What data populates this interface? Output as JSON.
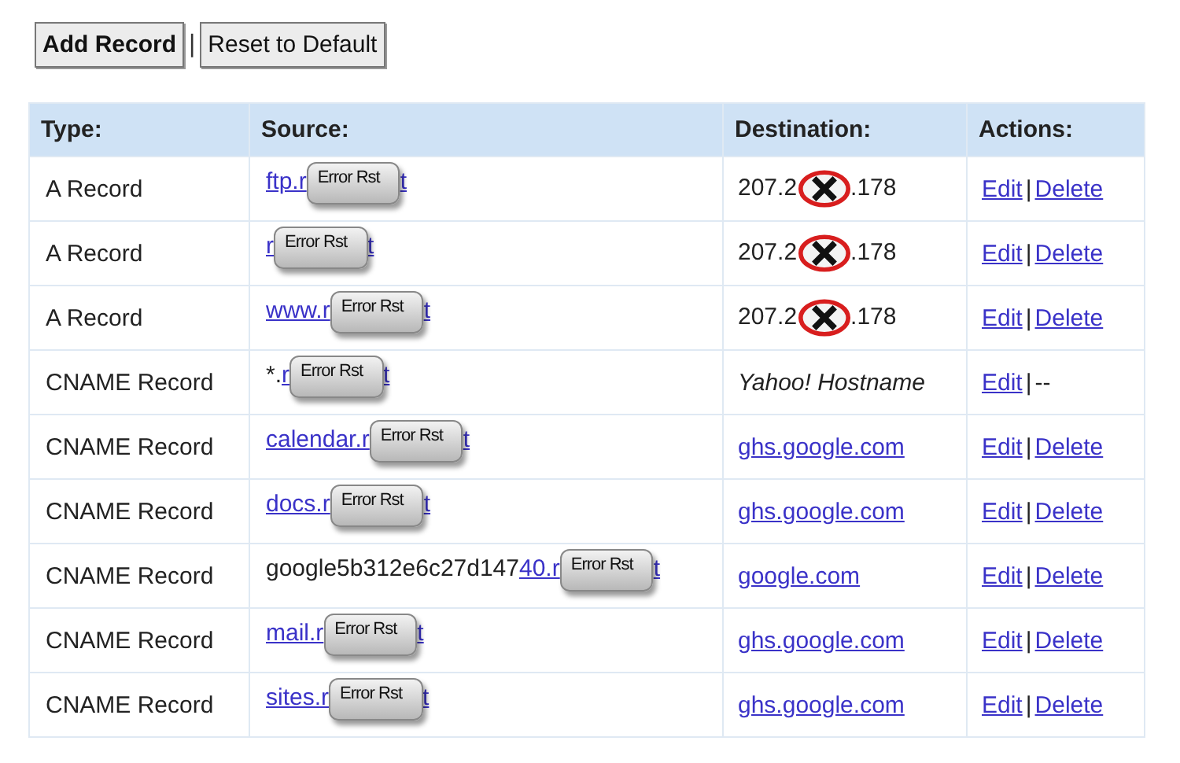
{
  "toolbar": {
    "buttons": [
      {
        "label": "Add Record",
        "kind": "primary"
      },
      {
        "label": "Reset to Default",
        "kind": "normal"
      }
    ],
    "separator": "|"
  },
  "table": {
    "columns": [
      "Type:",
      "Source:",
      "Destination:",
      "Actions:"
    ],
    "rows": [
      {
        "type": "A Record",
        "source": {
          "link": "ftp.r",
          "sticker": "Error Rst",
          "tail": "t"
        },
        "destination": {
          "kind": "masked",
          "before": "207.2",
          "after": ".178"
        },
        "actions": [
          {
            "label": "Edit",
            "kind": "link"
          },
          {
            "label": "Delete",
            "kind": "link"
          }
        ],
        "separator": "|"
      },
      {
        "type": "A Record",
        "source": {
          "link": "r",
          "sticker": "Error Rst",
          "tail": "t"
        },
        "destination": {
          "kind": "masked",
          "before": "207.2",
          "after": ".178"
        },
        "actions": [
          {
            "label": "Edit",
            "kind": "link"
          },
          {
            "label": "Delete",
            "kind": "link"
          }
        ],
        "separator": "|"
      },
      {
        "type": "A Record",
        "source": {
          "link": "www.r",
          "sticker": "Error Rst",
          "tail": "t"
        },
        "destination": {
          "kind": "masked",
          "before": "207.2",
          "after": ".178"
        },
        "actions": [
          {
            "label": "Edit",
            "kind": "link"
          },
          {
            "label": "Delete",
            "kind": "link"
          }
        ],
        "separator": "|"
      },
      {
        "type": "CNAME Record",
        "source": {
          "prefix": "*.",
          "link": "r",
          "sticker": "Error Rst",
          "tail": "t"
        },
        "destination": {
          "kind": "note",
          "text": "Yahoo! Hostname"
        },
        "actions": [
          {
            "label": "Edit",
            "kind": "link"
          },
          {
            "label": "--",
            "kind": "text"
          }
        ],
        "separator": "|"
      },
      {
        "type": "CNAME Record",
        "source": {
          "link": "calendar.r",
          "sticker": "Error Rst",
          "tail": "t"
        },
        "destination": {
          "kind": "link",
          "text": "ghs.google.com"
        },
        "actions": [
          {
            "label": "Edit",
            "kind": "link"
          },
          {
            "label": "Delete",
            "kind": "link"
          }
        ],
        "separator": "|"
      },
      {
        "type": "CNAME Record",
        "source": {
          "link": "docs.r",
          "sticker": "Error Rst",
          "tail": "t"
        },
        "destination": {
          "kind": "link",
          "text": "ghs.google.com"
        },
        "actions": [
          {
            "label": "Edit",
            "kind": "link"
          },
          {
            "label": "Delete",
            "kind": "link"
          }
        ],
        "separator": "|"
      },
      {
        "type": "CNAME Record",
        "source": {
          "prefix": "google5b312e6c27d147",
          "link": "40.r",
          "sticker": "Error Rst",
          "tail": "t"
        },
        "destination": {
          "kind": "link",
          "text": "google.com"
        },
        "actions": [
          {
            "label": "Edit",
            "kind": "link"
          },
          {
            "label": "Delete",
            "kind": "link"
          }
        ],
        "separator": "|"
      },
      {
        "type": "CNAME Record",
        "source": {
          "link": "mail.r",
          "sticker": "Error Rst",
          "tail": "t"
        },
        "destination": {
          "kind": "link",
          "text": "ghs.google.com"
        },
        "actions": [
          {
            "label": "Edit",
            "kind": "link"
          },
          {
            "label": "Delete",
            "kind": "link"
          }
        ],
        "separator": "|"
      },
      {
        "type": "CNAME Record",
        "source": {
          "link": "sites.r",
          "sticker": "Error Rst",
          "tail": "t"
        },
        "destination": {
          "kind": "link",
          "text": "ghs.google.com"
        },
        "actions": [
          {
            "label": "Edit",
            "kind": "link"
          },
          {
            "label": "Delete",
            "kind": "link"
          }
        ],
        "separator": "|"
      }
    ]
  }
}
